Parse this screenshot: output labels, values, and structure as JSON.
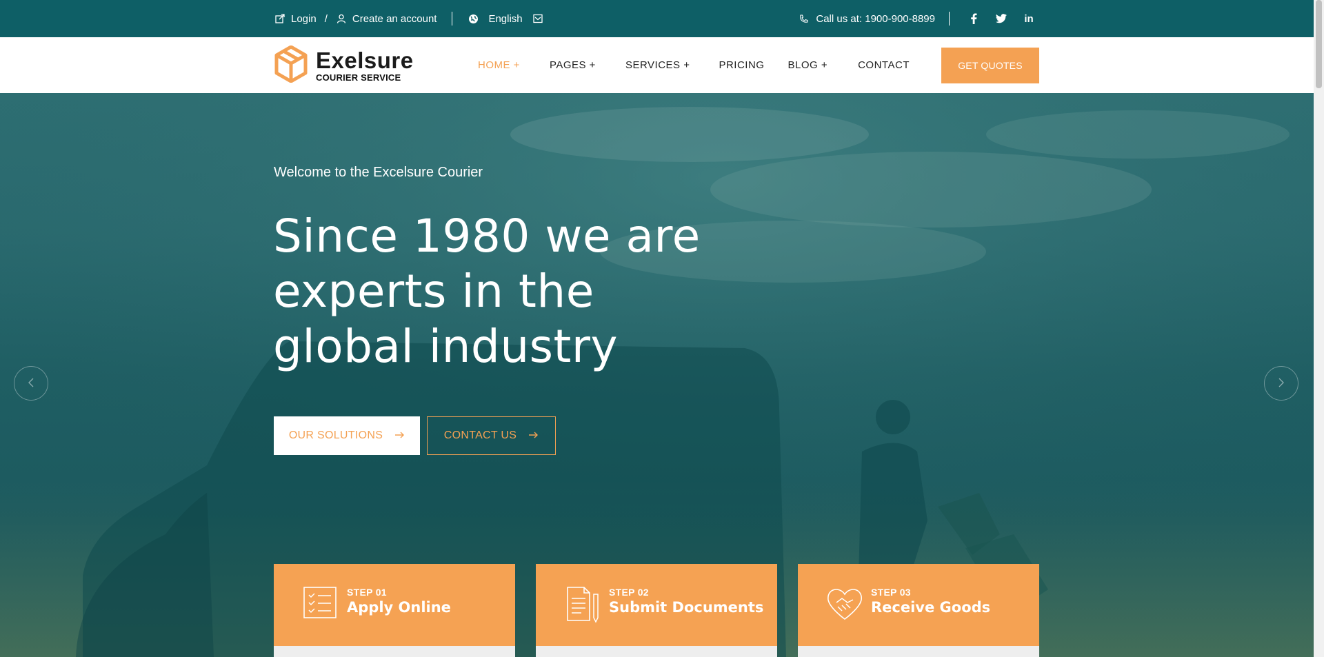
{
  "topbar": {
    "login": "Login",
    "slash": "/",
    "create_account": "Create an account",
    "language": "English",
    "call": "Call us at: 1900-900-8899",
    "social": [
      "f",
      "t",
      "in"
    ]
  },
  "brand": {
    "name": "Exelsure",
    "tagline": "COURIER SERVICE",
    "accent": "#f4a153"
  },
  "nav": {
    "items": [
      "HOME +",
      "PAGES +",
      "SERVICES +",
      "PRICING",
      "BLOG +",
      "CONTACT"
    ],
    "cta": "GET QUOTES"
  },
  "hero": {
    "welcome": "Welcome to the Excelsure Courier",
    "headline": "Since 1980 we are experts in the global industry",
    "btn_solutions": "OUR SOLUTIONS",
    "btn_contact": "CONTACT US"
  },
  "steps": [
    {
      "num": "STEP 01",
      "title": "Apply Online",
      "icon": "checklist-icon"
    },
    {
      "num": "STEP 02",
      "title": "Submit Documents",
      "icon": "documents-icon"
    },
    {
      "num": "STEP 03",
      "title": "Receive Goods",
      "icon": "handshake-icon"
    }
  ],
  "colors": {
    "topbar": "#0e5f66",
    "accent": "#f4a153",
    "hero_overlay": "#1f5e63"
  }
}
